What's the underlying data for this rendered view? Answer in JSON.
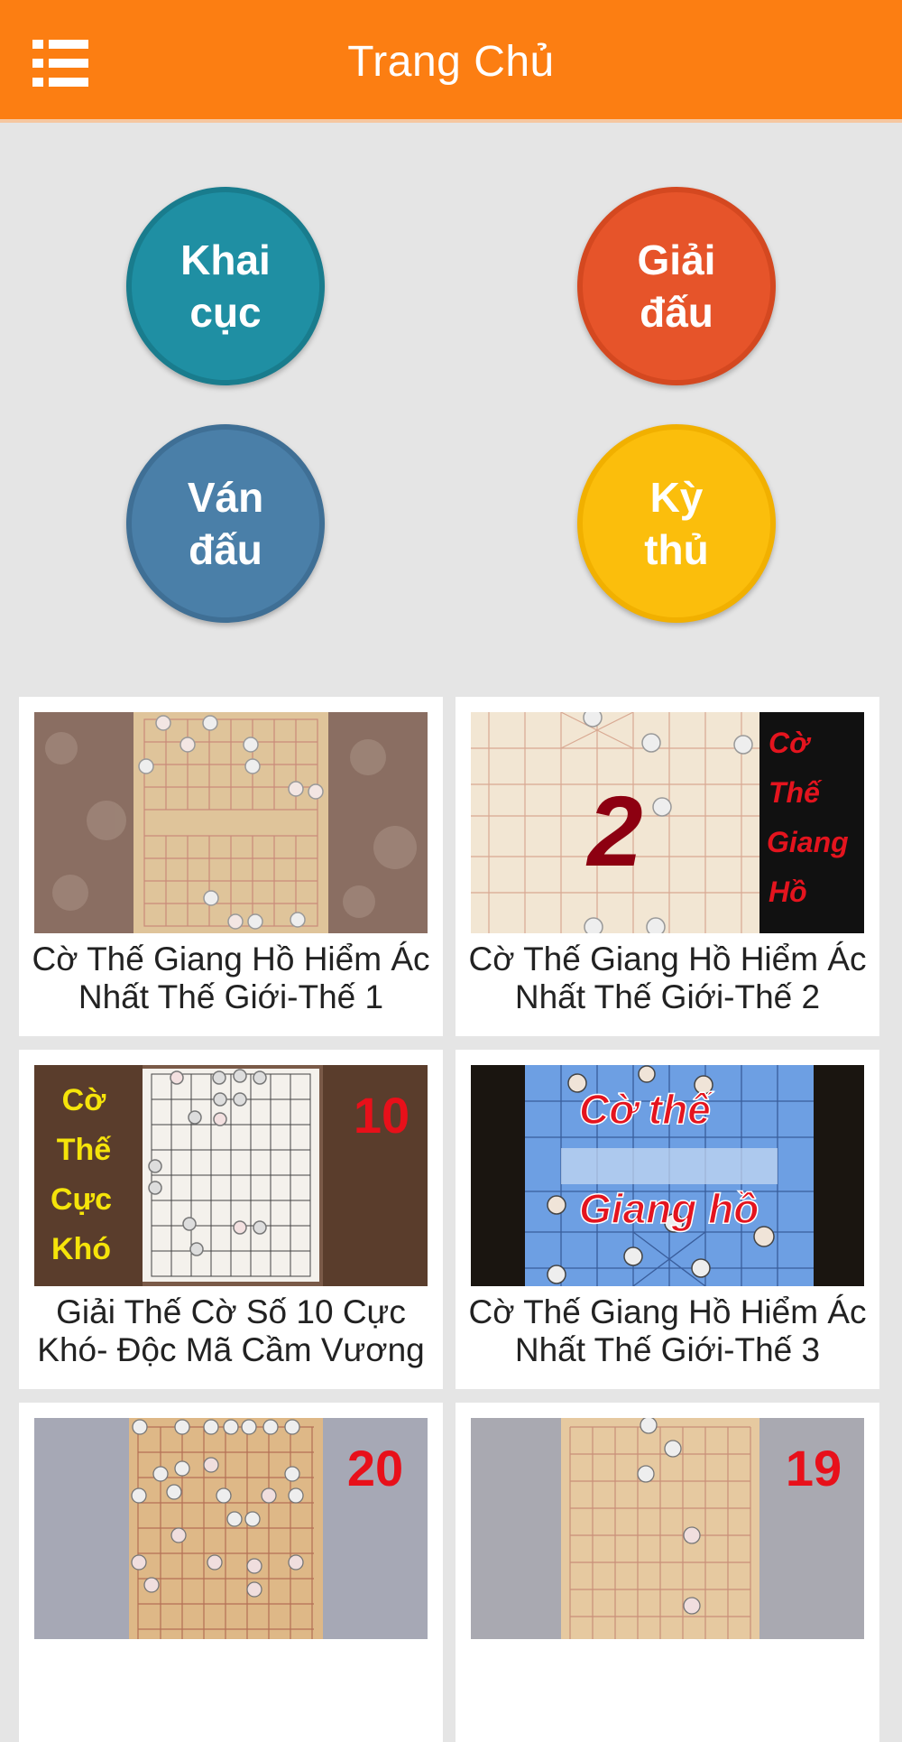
{
  "header": {
    "title": "Trang Chủ"
  },
  "menu": [
    {
      "label": "Khai\ncục",
      "color": "#1f8fa3",
      "border": "#197c8d"
    },
    {
      "label": "Giải\nđấu",
      "color": "#e6542a",
      "border": "#d44820"
    },
    {
      "label": "Ván\nđấu",
      "color": "#4a7fa8",
      "border": "#3f6f95"
    },
    {
      "label": "Kỳ\nthủ",
      "color": "#fbbe0c",
      "border": "#f1b000"
    }
  ],
  "videos": [
    {
      "title": "Cờ Thế Giang Hồ Hiểm Ác Nhất Thế Giới-Thế 1"
    },
    {
      "title": "Cờ Thế Giang Hồ Hiểm Ác Nhất Thế Giới-Thế 2",
      "overlay_number": "2",
      "side_text": [
        "Cờ",
        "Thế",
        "Giang",
        "Hồ"
      ]
    },
    {
      "title": "Giải Thế Cờ Số 10 Cực Khó- Độc Mã Cầm Vương",
      "overlay_number": "10",
      "side_text": [
        "Cờ",
        "Thế",
        "Cực",
        "Khó"
      ]
    },
    {
      "title": "Cờ Thế Giang Hồ Hiểm Ác Nhất Thế Giới-Thế 3",
      "overlay_text": [
        "Cờ thế",
        "Giang hồ"
      ]
    },
    {
      "title": "",
      "overlay_number": "20"
    },
    {
      "title": "",
      "overlay_number": "19"
    }
  ],
  "colors": {
    "header": "#fc7e12",
    "background": "#e5e5e5"
  }
}
